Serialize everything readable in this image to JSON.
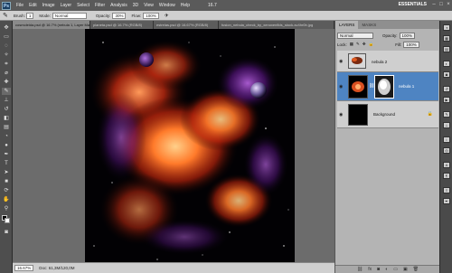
{
  "menubar": {
    "logo": "Ps",
    "items": [
      "File",
      "Edit",
      "Image",
      "Layer",
      "Select",
      "Filter",
      "Analysis",
      "3D",
      "View",
      "Window",
      "Help"
    ],
    "zoom": "16.7",
    "workspace": "ESSENTIALS"
  },
  "options": {
    "brush_label": "Brush:",
    "brush_size": "1",
    "mode_label": "Mode:",
    "mode_value": "Normal",
    "opacity_label": "Opacity:",
    "opacity_value": "30%",
    "flow_label": "Flow:",
    "flow_value": "100%"
  },
  "tabs": [
    {
      "label": "cosmoleida.psd @ 16.7% (nebula 1, Layer Mask/8) *",
      "active": true
    },
    {
      "label": "planeta.psd @ 16.7% (RGB/8)",
      "active": false
    },
    {
      "label": "estrelas.psd @ 16.67% (RGB/8)",
      "active": false
    },
    {
      "label": "fusion_nebula_check_by_xenoxenflds_stock-sv4hr0b.jpg",
      "active": false
    }
  ],
  "status": {
    "zoom": "16.67%",
    "doc": "Doc: 61,3M/120,0M"
  },
  "layers_panel": {
    "tab_layers": "LAYERS",
    "tab_masks": "MASKS",
    "blend_mode": "Normal",
    "opacity_label": "Opacity:",
    "opacity_value": "100%",
    "lock_label": "Lock:",
    "fill_label": "Fill:",
    "fill_value": "100%",
    "layers": [
      {
        "name": "nebula 2",
        "selected": false
      },
      {
        "name": "nebula 1",
        "selected": true
      },
      {
        "name": "Background",
        "selected": false
      }
    ]
  },
  "colors": {
    "canvas_bg": "#000000",
    "selected_layer": "#4e84c2",
    "nebula_core": "#ff7a2a",
    "nebula_purple": "#a63cd6"
  }
}
